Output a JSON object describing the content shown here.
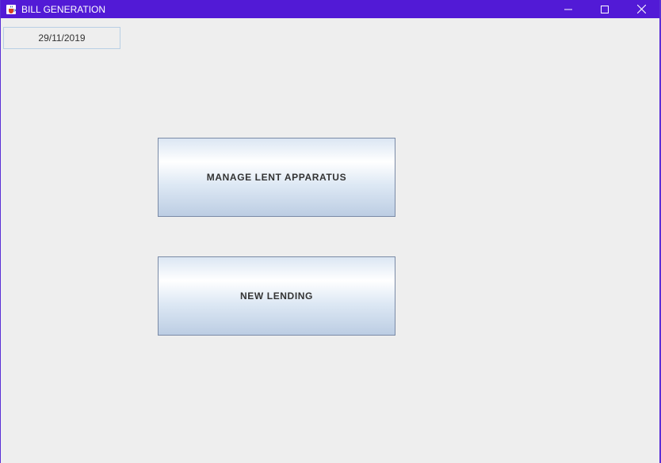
{
  "window": {
    "title": "BILL GENERATION",
    "icons": {
      "app": "java-cup-icon",
      "minimize": "minimize-icon",
      "maximize": "maximize-icon",
      "close": "close-icon"
    },
    "colors": {
      "titlebar": "#521ad6",
      "background": "#eeeeee"
    }
  },
  "date_field": {
    "value": "29/11/2019"
  },
  "buttons": {
    "manage_label": "MANAGE LENT APPARATUS",
    "new_label": "NEW LENDING"
  }
}
